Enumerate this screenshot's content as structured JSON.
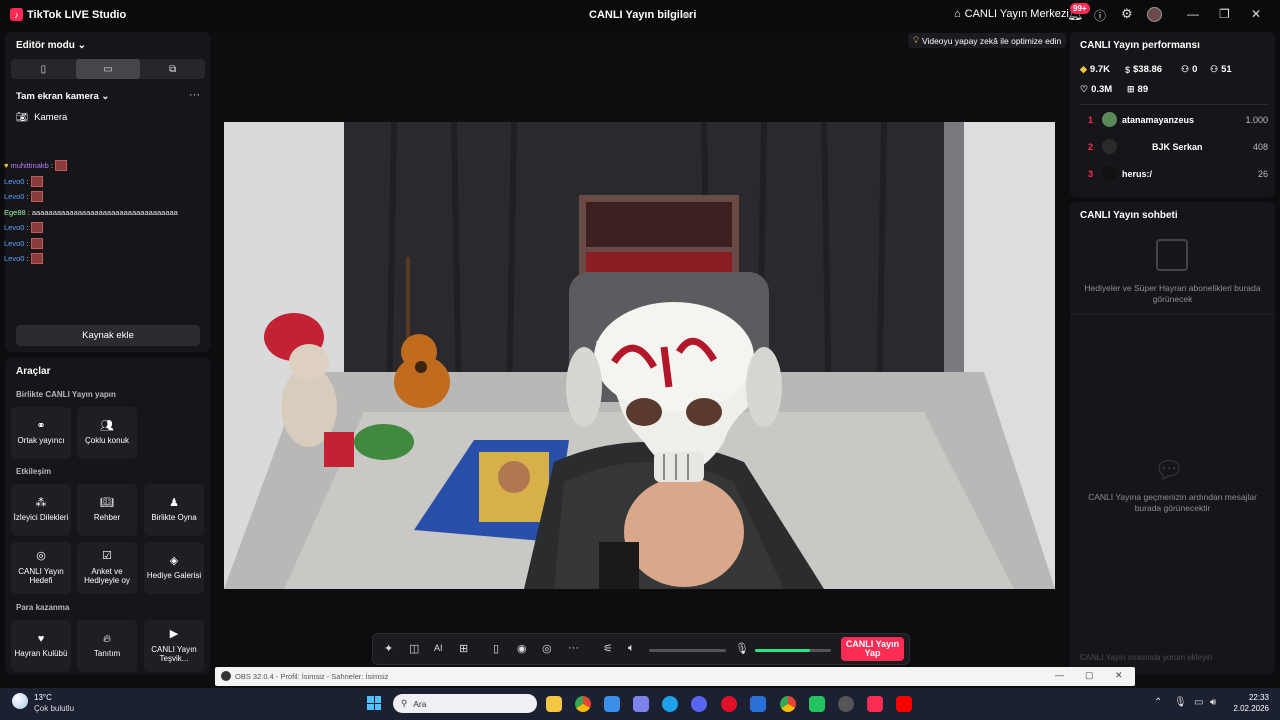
{
  "titlebar": {
    "app_title": "TikTok LIVE Studio",
    "center_title": "CANLI Yayın bilgileri",
    "live_center": "CANLI Yayın Merkezi",
    "notification_badge": "99+"
  },
  "left_panel": {
    "editor_mode": "Editör modu",
    "scene_name": "Tam ekran kamera",
    "source_camera": "Kamera",
    "add_source": "Kaynak ekle",
    "chat_overlay": [
      {
        "user": "muhittinakb",
        "text": ":"
      },
      {
        "user": "Levo0",
        "text": ":"
      },
      {
        "user": "Levo0",
        "text": ":"
      },
      {
        "user": "Ege88",
        "text": ": aaaaaaaaaaaaaaaaaaaaaaaaaaaaaaaaaaa"
      },
      {
        "user": "Levo0",
        "text": ":"
      },
      {
        "user": "Levo0",
        "text": ":"
      },
      {
        "user": "Levo0",
        "text": ":"
      }
    ]
  },
  "tools": {
    "title": "Araçlar",
    "section_collab": "Birlikte CANLI Yayın yapın",
    "section_interaction": "Etkileşim",
    "section_monetize": "Para kazanma",
    "co_host": "Ortak yayıncı",
    "multi_guest": "Çoklu konuk",
    "viewer_requests": "İzleyici Dilekleri",
    "guide": "Rehber",
    "play_together": "Birlikte Oyna",
    "live_goal": "CANLI Yayın Hedefi",
    "poll_gift": "Anket ve Hediyeyle oy",
    "gift_gallery": "Hediye Galerisi",
    "fan_club": "Hayran Kulübü",
    "promote": "Tanıtım",
    "live_incentive": "CANLI Yayın Teşvik..."
  },
  "stage": {
    "ai_tip": "Videoyu yapay zekâ ile optimize edin",
    "go_live": "CANLI Yayın Yap",
    "mic_level": 0.73,
    "volume_level": 0.0
  },
  "performance": {
    "title": "CANLI Yayın performansı",
    "diamonds": "9.7K",
    "earnings": "$38.86",
    "new_followers": "0",
    "viewers": "51",
    "likes": "0.3M",
    "gifters": "89",
    "ranking": [
      {
        "rank": "1",
        "name": "atanamayanzeus",
        "score": "1.000",
        "color": "#5b8a5a"
      },
      {
        "rank": "2",
        "name": "BJK Serkan",
        "score": "408",
        "color": "#2a2a2a"
      },
      {
        "rank": "3",
        "name": "herus:/",
        "score": "26",
        "color": "#111111"
      }
    ]
  },
  "live_chat": {
    "title": "CANLI Yayın sohbeti",
    "gift_message": "Hediyeler ve Süper Hayran abonelikleri burada görünecek",
    "empty_message": "CANLI Yayına geçmenizin ardından mesajlar burada görünecektir",
    "comment_placeholder": "CANLI Yayın sırasında yorum ekleyin"
  },
  "obs": {
    "title": "OBS 32.0.4 - Profil: İsimsiz - Sahneler: İsimsiz"
  },
  "taskbar": {
    "temperature": "13°C",
    "condition": "Çok bulutlu",
    "search": "Ara",
    "time": "22:33",
    "date": "2.02.2026"
  },
  "colors": {
    "accent": "#fe2c55",
    "mic_green": "#22e58a",
    "panel": "#16161a"
  }
}
